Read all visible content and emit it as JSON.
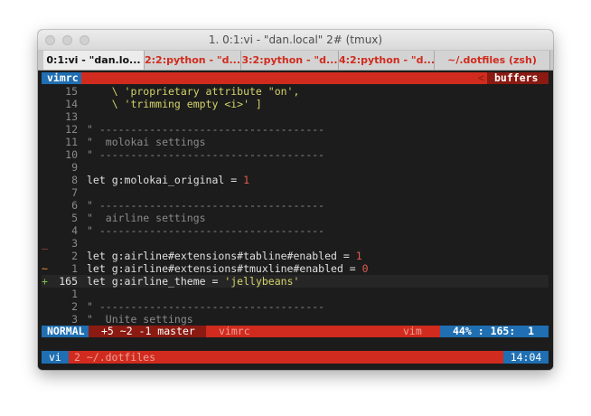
{
  "window": {
    "title": "1. 0:1:vi - \"dan.local\" 2# (tmux)"
  },
  "tabs": [
    {
      "label": "0:1:vi - \"dan.lo...",
      "active": true
    },
    {
      "label": "2:2:python - \"d...",
      "active": false
    },
    {
      "label": "3:2:python - \"d...",
      "active": false
    },
    {
      "label": "4:2:python - \"d...",
      "active": false
    },
    {
      "label": "~/.dotfiles (zsh)",
      "active": false
    }
  ],
  "vim_tabline": {
    "left_label": "vimrc",
    "right_label": "buffers",
    "separator": "<"
  },
  "editor_lines": [
    {
      "num": "15",
      "sign": "",
      "text": "    \\ 'proprietary attribute \"on',",
      "kind": "str"
    },
    {
      "num": "14",
      "sign": "",
      "text": "    \\ 'trimming empty <i>' ]",
      "kind": "str"
    },
    {
      "num": "13",
      "sign": "",
      "text": "",
      "kind": "plain"
    },
    {
      "num": "12",
      "sign": "",
      "text": "\" ------------------------------------",
      "kind": "cmt"
    },
    {
      "num": "11",
      "sign": "",
      "text": "\"  molokai settings",
      "kind": "cmt"
    },
    {
      "num": "10",
      "sign": "",
      "text": "\" ------------------------------------",
      "kind": "cmt"
    },
    {
      "num": "9",
      "sign": "",
      "text": "",
      "kind": "plain"
    },
    {
      "num": "8",
      "sign": "",
      "text": "let g:molokai_original = 1",
      "kind": "let"
    },
    {
      "num": "7",
      "sign": "",
      "text": "",
      "kind": "plain"
    },
    {
      "num": "6",
      "sign": "",
      "text": "\" ------------------------------------",
      "kind": "cmt"
    },
    {
      "num": "5",
      "sign": "",
      "text": "\"  airline settings",
      "kind": "cmt"
    },
    {
      "num": "4",
      "sign": "",
      "text": "\" ------------------------------------",
      "kind": "cmt"
    },
    {
      "num": "3",
      "sign": "_",
      "text": "",
      "kind": "plain"
    },
    {
      "num": "2",
      "sign": "",
      "text": "let g:airline#extensions#tabline#enabled = 1",
      "kind": "let"
    },
    {
      "num": "1",
      "sign": "~",
      "text": "let g:airline#extensions#tmuxline#enabled = 0",
      "kind": "let"
    },
    {
      "num": "165",
      "sign": "+",
      "text": "let g:airline_theme = 'jellybeans'",
      "kind": "cursor"
    },
    {
      "num": "1",
      "sign": "",
      "text": "",
      "kind": "plain"
    },
    {
      "num": "2",
      "sign": "",
      "text": "\" ------------------------------------",
      "kind": "cmt"
    },
    {
      "num": "3",
      "sign": "",
      "text": "\"  Unite settings",
      "kind": "cmt"
    }
  ],
  "statusline": {
    "mode": "NORMAL",
    "git": "+5 ~2 -1 master",
    "file": "vimrc",
    "filetype": "vim",
    "percent": "44%",
    "position": "165:  1"
  },
  "tmux_status": {
    "left": "vi",
    "window": "2 ~/.dotfiles",
    "time": "14:04"
  },
  "colors": {
    "red": "#d02b1e",
    "blue": "#1f6fb2",
    "orange": "#e8932c",
    "green": "#7bc043"
  }
}
